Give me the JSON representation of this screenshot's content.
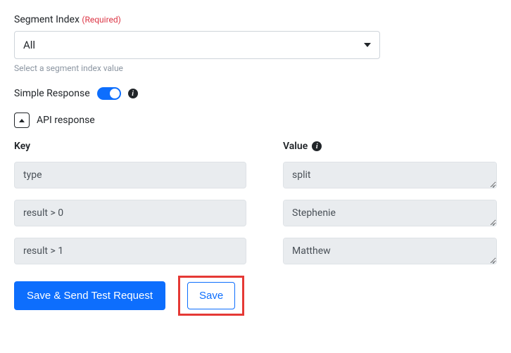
{
  "segmentIndex": {
    "label": "Segment Index",
    "requiredTag": "(Required)",
    "value": "All",
    "helper": "Select a segment index value"
  },
  "simpleResponse": {
    "label": "Simple Response"
  },
  "apiResponse": {
    "title": "API response",
    "keyHeader": "Key",
    "valueHeader": "Value",
    "rows": [
      {
        "key": "type",
        "value": "split"
      },
      {
        "key": "result > 0",
        "value": "Stephenie"
      },
      {
        "key": "result > 1",
        "value": "Matthew"
      }
    ]
  },
  "buttons": {
    "saveAndSend": "Save & Send Test Request",
    "save": "Save"
  }
}
